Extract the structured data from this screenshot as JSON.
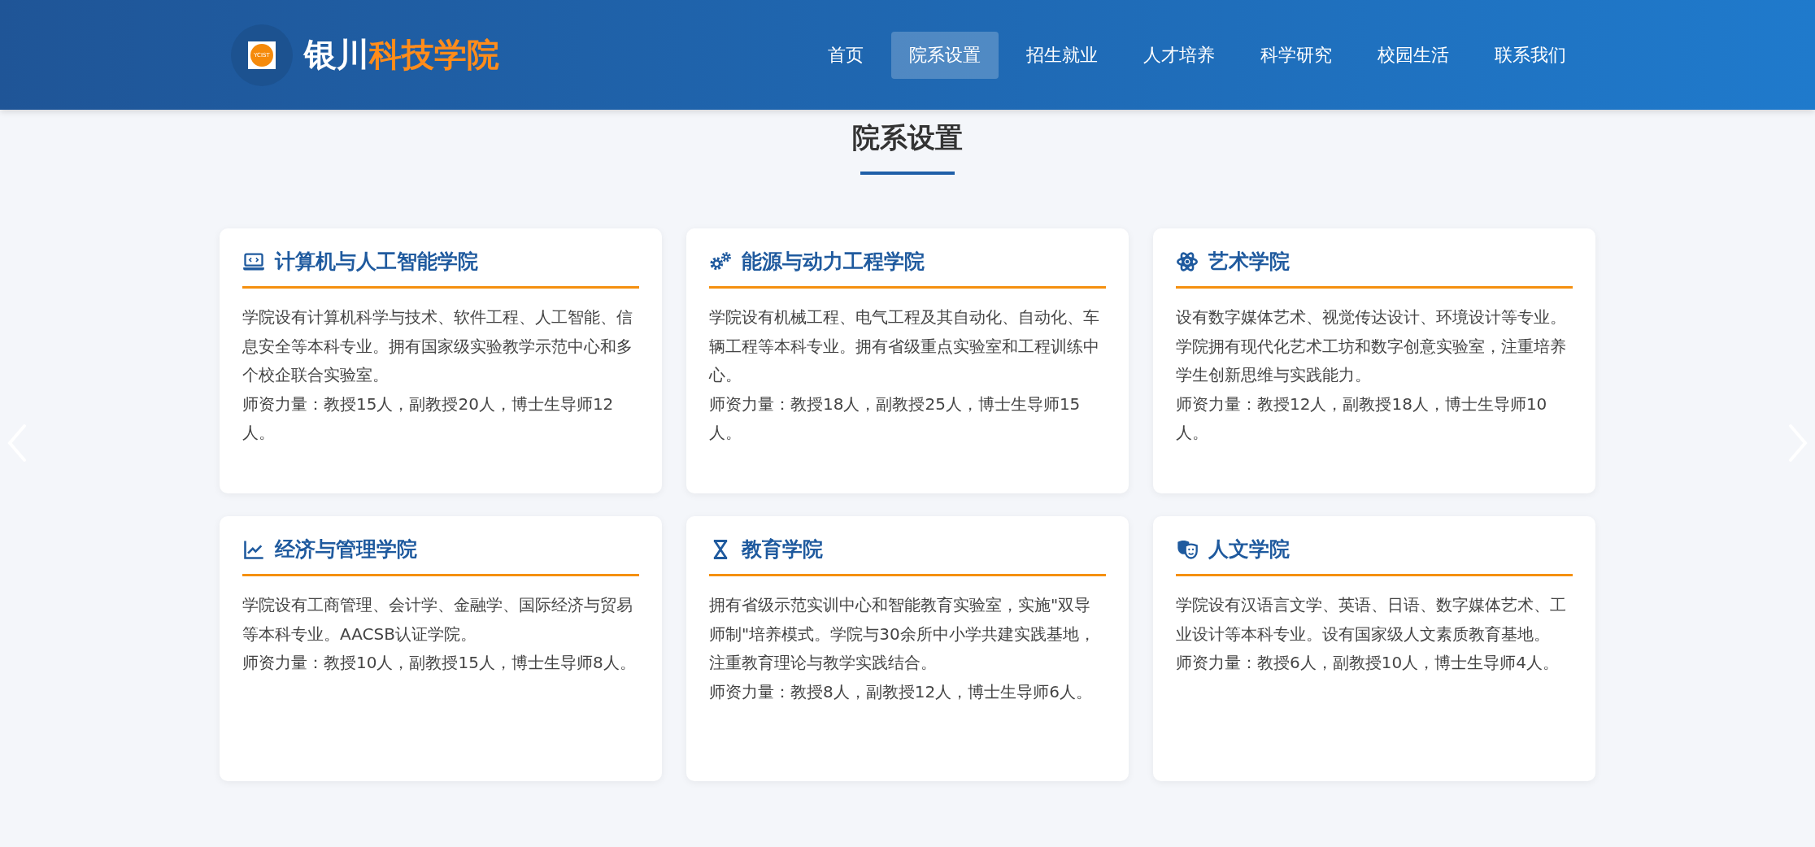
{
  "header": {
    "logo_mark": "YCIST",
    "brand_part_1": "银川",
    "brand_part_2": "科技学院",
    "nav": [
      {
        "label": "首页",
        "selected": false
      },
      {
        "label": "院系设置",
        "selected": true
      },
      {
        "label": "招生就业",
        "selected": false
      },
      {
        "label": "人才培养",
        "selected": false
      },
      {
        "label": "科学研究",
        "selected": false
      },
      {
        "label": "校园生活",
        "selected": false
      },
      {
        "label": "联系我们",
        "selected": false
      }
    ]
  },
  "section": {
    "title": "院系设置",
    "cards": [
      {
        "title": "计算机与人工智能学院",
        "description": "学院设有计算机科学与技术、软件工程、人工智能、信息安全等本科专业。拥有国家级实验教学示范中心和多个校企联合实验室。",
        "faculty": "师资力量：教授15人，副教授20人，博士生导师12人。"
      },
      {
        "title": "能源与动力工程学院",
        "description": "学院设有机械工程、电气工程及其自动化、自动化、车辆工程等本科专业。拥有省级重点实验室和工程训练中心。",
        "faculty": "师资力量：教授18人，副教授25人，博士生导师15人。"
      },
      {
        "title": "艺术学院",
        "description": "设有数字媒体艺术、视觉传达设计、环境设计等专业。学院拥有现代化艺术工坊和数字创意实验室，注重培养学生创新思维与实践能力。",
        "faculty": "师资力量：教授12人，副教授18人，博士生导师10人。"
      },
      {
        "title": "经济与管理学院",
        "description": "学院设有工商管理、会计学、金融学、国际经济与贸易等本科专业。AACSB认证学院。",
        "faculty": "师资力量：教授10人，副教授15人，博士生导师8人。"
      },
      {
        "title": "教育学院",
        "description": "拥有省级示范实训中心和智能教育实验室，实施\"双导师制\"培养模式。学院与30余所中小学共建实践基地，注重教育理论与教学实践结合。",
        "faculty": "师资力量：教授8人，副教授12人，博士生导师6人。"
      },
      {
        "title": "人文学院",
        "description": "学院设有汉语言文学、英语、日语、数字媒体艺术、工业设计等本科专业。设有国家级人文素质教育基地。",
        "faculty": "师资力量：教授6人，副教授10人，博士生导师4人。"
      }
    ]
  }
}
